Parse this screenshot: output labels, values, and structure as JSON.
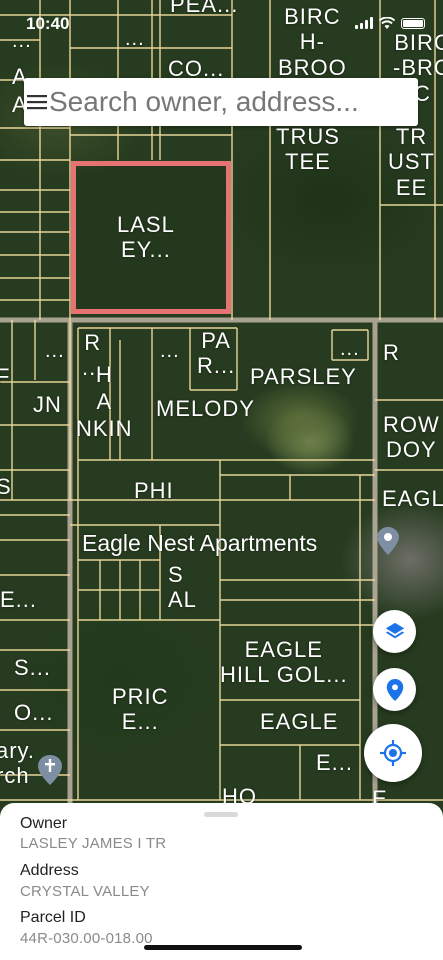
{
  "status_bar": {
    "time": "10:40"
  },
  "search": {
    "placeholder": "Search owner, address..."
  },
  "map": {
    "labels": {
      "top_col1": "...",
      "top_col2": "...",
      "top_pea": "PEA...",
      "co": "CO...",
      "a_left": "A",
      "a_left2": "A",
      "birch_hbroo": "BIRC\nH-\nBROO",
      "birch_right": "BIRC\n-BRO\nC",
      "trus_tee": "TRUS\nTEE",
      "tr_ust_ee": "TR\nUST\nEE",
      "lasley": "LASL\nEY...",
      "dots_a": "...",
      "dots_b": "...",
      "r_dots": "R\n...",
      "par_r": "PA\nR...",
      "dots_c": "...",
      "r_right": "R",
      "f_left": "F",
      "jn": "JN",
      "hankin": "H\nA\nNKIN",
      "parsley": "PARSLEY",
      "melody": "MELODY",
      "rowdoy": "ROW\nDOY",
      "s_left": "S",
      "phi": "PHI",
      "eagle_right": "EAGL",
      "eagle_nest": "Eagle Nest Apartments",
      "s_al": "S\nAL",
      "e_left": "E...",
      "s_dots": "S...",
      "o_dots": "O...",
      "price": "PRIC\nE...",
      "eagle_hill": "EAGLE\nHILL GOL...",
      "eagle_mid": "EAGLE",
      "e_mid": "E...",
      "ho": "HO",
      "calvary": "ary.\nrch",
      "e_right": "E"
    }
  },
  "bottom_sheet": {
    "owner_label": "Owner",
    "owner_value": "LASLEY JAMES I TR",
    "address_label": "Address",
    "address_value": "CRYSTAL VALLEY",
    "parcel_label": "Parcel ID",
    "parcel_value": "44R-030.00-018.00"
  },
  "icons": {
    "menu": "menu-icon",
    "layers": "layers-icon",
    "pin": "location-pin-icon",
    "locate": "my-location-icon",
    "church": "church-icon",
    "apartment": "apartment-pin-icon"
  },
  "colors": {
    "parcel_line": "#f3e0a2",
    "road": "#bcb2a0",
    "selected_outline": "#e57373",
    "fab_icon": "#1a73e8"
  }
}
